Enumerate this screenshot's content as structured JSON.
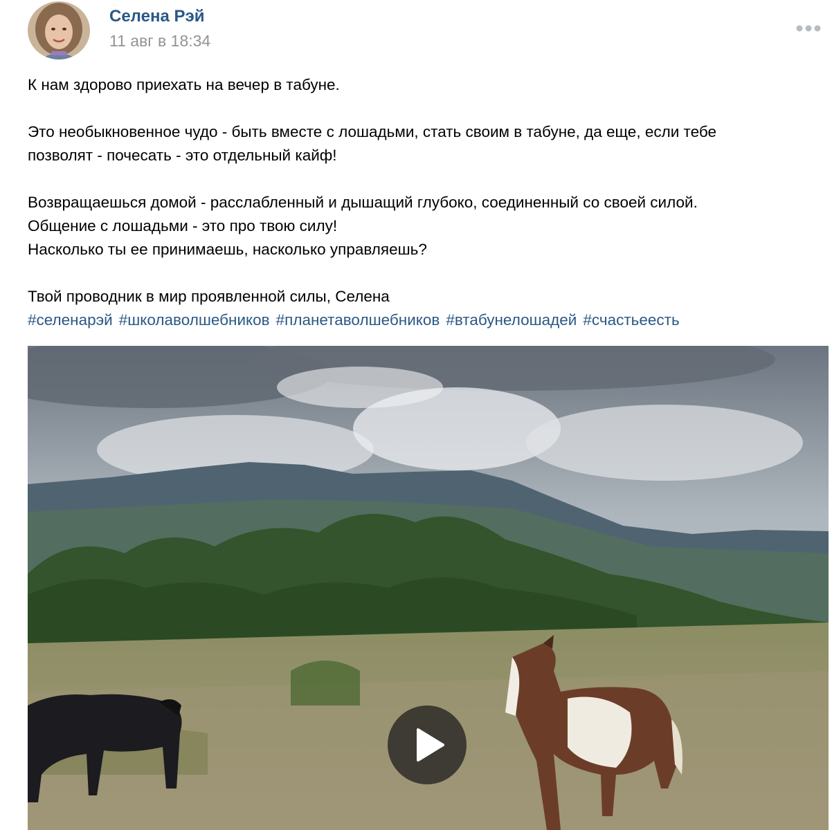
{
  "author": {
    "name": "Селена Рэй",
    "date": "11 авг в 18:34",
    "avatar_icon": "avatar-photo"
  },
  "menu": {
    "icon": "more-dots-icon"
  },
  "post": {
    "line1": "К нам здорово приехать на вечер в табуне.",
    "line2": "Это необыкновенное чудо - быть вместе с лошадьми, стать своим в табуне, да еще, если тебе",
    "line3": "позволят - почесать - это отдельный кайф!",
    "line4": "Возвращаешься домой - расслабленный и дышащий глубоко, соединенный со своей силой.",
    "line5": "Общение с лошадьми - это про твою силу!",
    "line6": "Насколько ты ее принимаешь, насколько управляешь?",
    "line7": "Твой проводник в мир проявленной силы, Селена",
    "hashtags": [
      "#селенарэй",
      "#школаволшебников",
      "#планетаволшебников",
      "#втабунелошадей",
      "#счастьеесть"
    ]
  },
  "video": {
    "play_icon": "play-icon",
    "scene": "horses-in-mountain-meadow"
  },
  "colors": {
    "link": "#2a5885",
    "date": "#939393",
    "text": "#000000"
  }
}
